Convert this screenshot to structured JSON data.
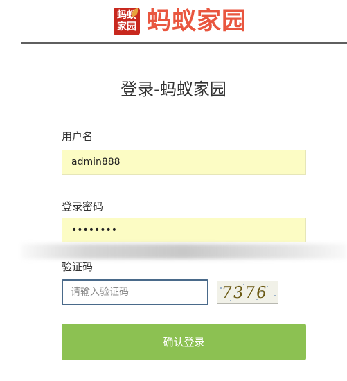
{
  "brand": {
    "badge_line1": "蚂蚁",
    "badge_line2": "家园",
    "logo_text": "蚂蚁家园"
  },
  "title": "登录-蚂蚁家园",
  "form": {
    "username_label": "用户名",
    "username_value": "admin888",
    "password_label": "登录密码",
    "password_value": "••••••••",
    "captcha_label": "验证码",
    "captcha_placeholder": "请输入验证码",
    "captcha_text": "7376",
    "submit_label": "确认登录"
  },
  "colors": {
    "brand_red": "#e9563f",
    "badge_red": "#c8281e",
    "autofill_yellow": "#fcfcc4",
    "submit_green": "#8cc152",
    "input_border": "#4a6a8a"
  }
}
